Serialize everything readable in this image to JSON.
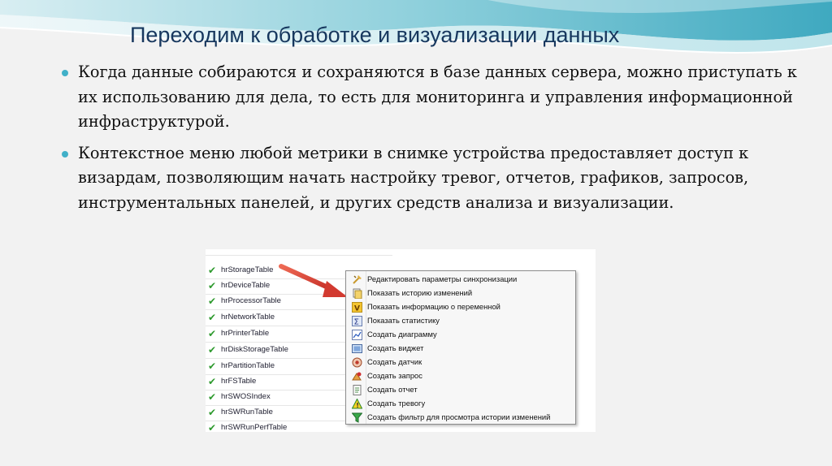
{
  "slide": {
    "title": "Переходим к обработке и визуализации данных",
    "bullets": [
      "Когда данные собираются и сохраняются в базе данных сервера, можно приступать к их использованию для дела, то есть для мониторинга и управления информационной инфраструктурой.",
      "Контекстное меню любой метрики в снимке устройства предоставляет доступ к визардам, позволяющим начать настройку тревог, отчетов, графиков, запросов, инструментальных панелей, и других средств анализа и визуализации."
    ],
    "accent_color": "#41b0c8",
    "title_color": "#17375e"
  },
  "screenshot": {
    "tree_items": [
      "hrStorageTable",
      "hrDeviceTable",
      "hrProcessorTable",
      "hrNetworkTable",
      "hrPrinterTable",
      "hrDiskStorageTable",
      "hrPartitionTable",
      "hrFSTable",
      "hrSWOSIndex",
      "hrSWRunTable",
      "hrSWRunPerfTable"
    ],
    "context_menu": [
      {
        "label": "Редактировать параметры синхронизации",
        "icon": "sync-settings-icon"
      },
      {
        "label": "Показать историю изменений",
        "icon": "history-icon"
      },
      {
        "label": "Показать информацию о переменной",
        "icon": "variable-info-icon"
      },
      {
        "label": "Показать статистику",
        "icon": "statistics-icon"
      },
      {
        "label": "Создать диаграмму",
        "icon": "chart-icon"
      },
      {
        "label": "Создать виджет",
        "icon": "widget-icon"
      },
      {
        "label": "Создать датчик",
        "icon": "sensor-icon"
      },
      {
        "label": "Создать запрос",
        "icon": "query-icon"
      },
      {
        "label": "Создать отчет",
        "icon": "report-icon"
      },
      {
        "label": "Создать тревогу",
        "icon": "alarm-icon"
      },
      {
        "label": "Создать фильтр для просмотра истории изменений",
        "icon": "filter-icon"
      }
    ],
    "arrow_color": "#e0443a"
  }
}
